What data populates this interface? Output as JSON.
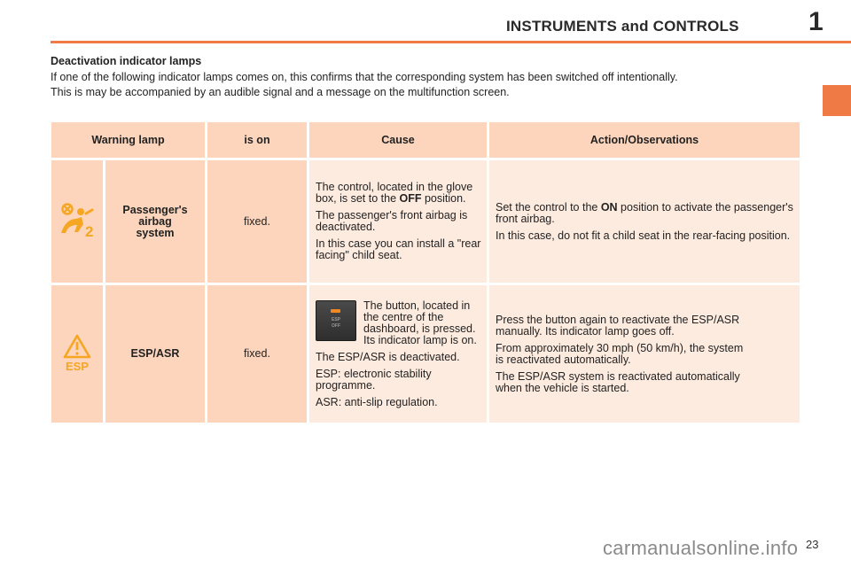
{
  "header": {
    "title": "INSTRUMENTS and CONTROLS",
    "chapter_number": "1",
    "accent_color": "#f07a45"
  },
  "section": {
    "title": "Deactivation indicator lamps",
    "intro": [
      "If one of the following indicator lamps comes on, this confirms that the corresponding system has been switched off intentionally.",
      "This is may be accompanied by an audible signal and a message on the multifunction screen."
    ]
  },
  "table": {
    "headers": {
      "warning_lamp": "Warning lamp",
      "is_on": "is on",
      "cause": "Cause",
      "action": "Action/Observations"
    },
    "rows": [
      {
        "icon": "passenger-airbag-off-icon",
        "icon_label": "2",
        "system": "Passenger's airbag system",
        "is_on": "fixed.",
        "cause": {
          "p1_pre": "The control, located in the glove box, is set to the ",
          "p1_kw": "OFF",
          "p1_post": " position.",
          "p2": "The passenger's front airbag is deactivated.",
          "p3": "In this case you can install a \"rear facing\" child seat."
        },
        "action": {
          "p1_pre": "Set the control to the ",
          "p1_kw": "ON",
          "p1_post": " position to activate the passenger's front airbag.",
          "p2": "In this case, do not fit a child seat in the rear-facing position."
        }
      },
      {
        "icon": "esp-warning-icon",
        "icon_label": "ESP",
        "system": "ESP/ASR",
        "is_on": "fixed.",
        "cause": {
          "button_label_1": "ESP",
          "button_label_2": "OFF",
          "p1": "The button, located in the centre of the dashboard, is pressed. Its indicator lamp is on.",
          "p2": "The ESP/ASR is deactivated.",
          "p3": "ESP: electronic stability programme.",
          "p4": "ASR: anti-slip regulation."
        },
        "action": {
          "p1": "Press the button again to reactivate the ESP/ASR manually. Its indicator lamp goes off.",
          "p2": "From approximately 30 mph (50 km/h), the system is reactivated automatically.",
          "p3": "The ESP/ASR system is reactivated automatically when the vehicle is started."
        }
      }
    ]
  },
  "footer": {
    "page_number": "23",
    "watermark": "carmanualsonline.info"
  }
}
